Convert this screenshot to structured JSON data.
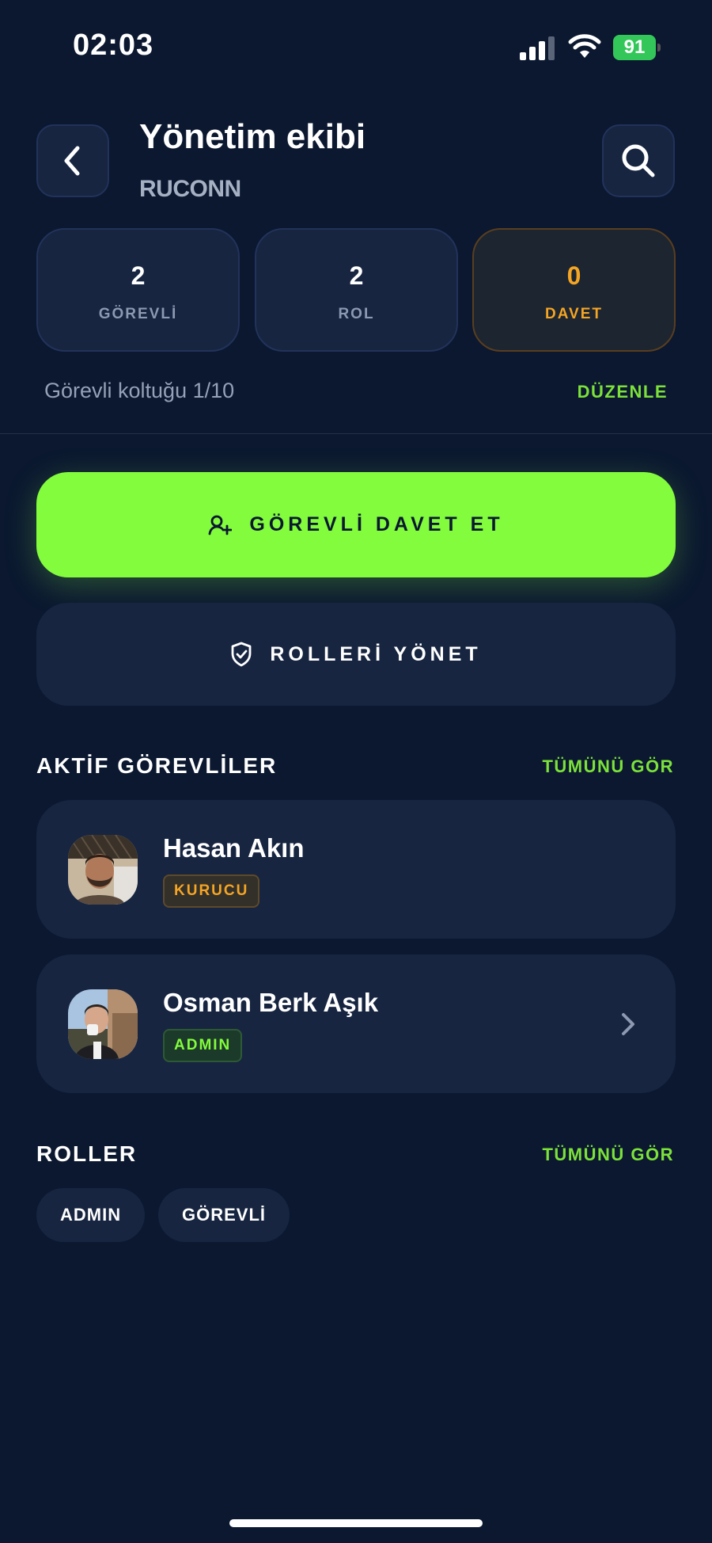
{
  "status_bar": {
    "time": "02:03",
    "battery": "91"
  },
  "header": {
    "title": "Yönetim ekibi",
    "subtitle": "RUCONN"
  },
  "stats": [
    {
      "value": "2",
      "label": "GÖREVLİ"
    },
    {
      "value": "2",
      "label": "ROL"
    },
    {
      "value": "0",
      "label": "DAVET"
    }
  ],
  "seats": {
    "text": "Görevli koltuğu 1/10",
    "edit_label": "DÜZENLE"
  },
  "actions": {
    "invite_label": "GÖREVLİ DAVET ET",
    "manage_roles_label": "ROLLERİ YÖNET"
  },
  "active_members": {
    "title": "AKTİF GÖREVLİLER",
    "see_all": "TÜMÜNÜ GÖR",
    "items": [
      {
        "name": "Hasan Akın",
        "role": "KURUCU"
      },
      {
        "name": "Osman Berk Aşık",
        "role": "ADMIN"
      }
    ]
  },
  "roles": {
    "title": "ROLLER",
    "see_all": "TÜMÜNÜ GÖR",
    "items": [
      "ADMIN",
      "GÖREVLİ"
    ]
  },
  "colors": {
    "accent": "#82fc3c",
    "warning": "#f5a524",
    "background": "#0b1830",
    "card": "#172541"
  }
}
